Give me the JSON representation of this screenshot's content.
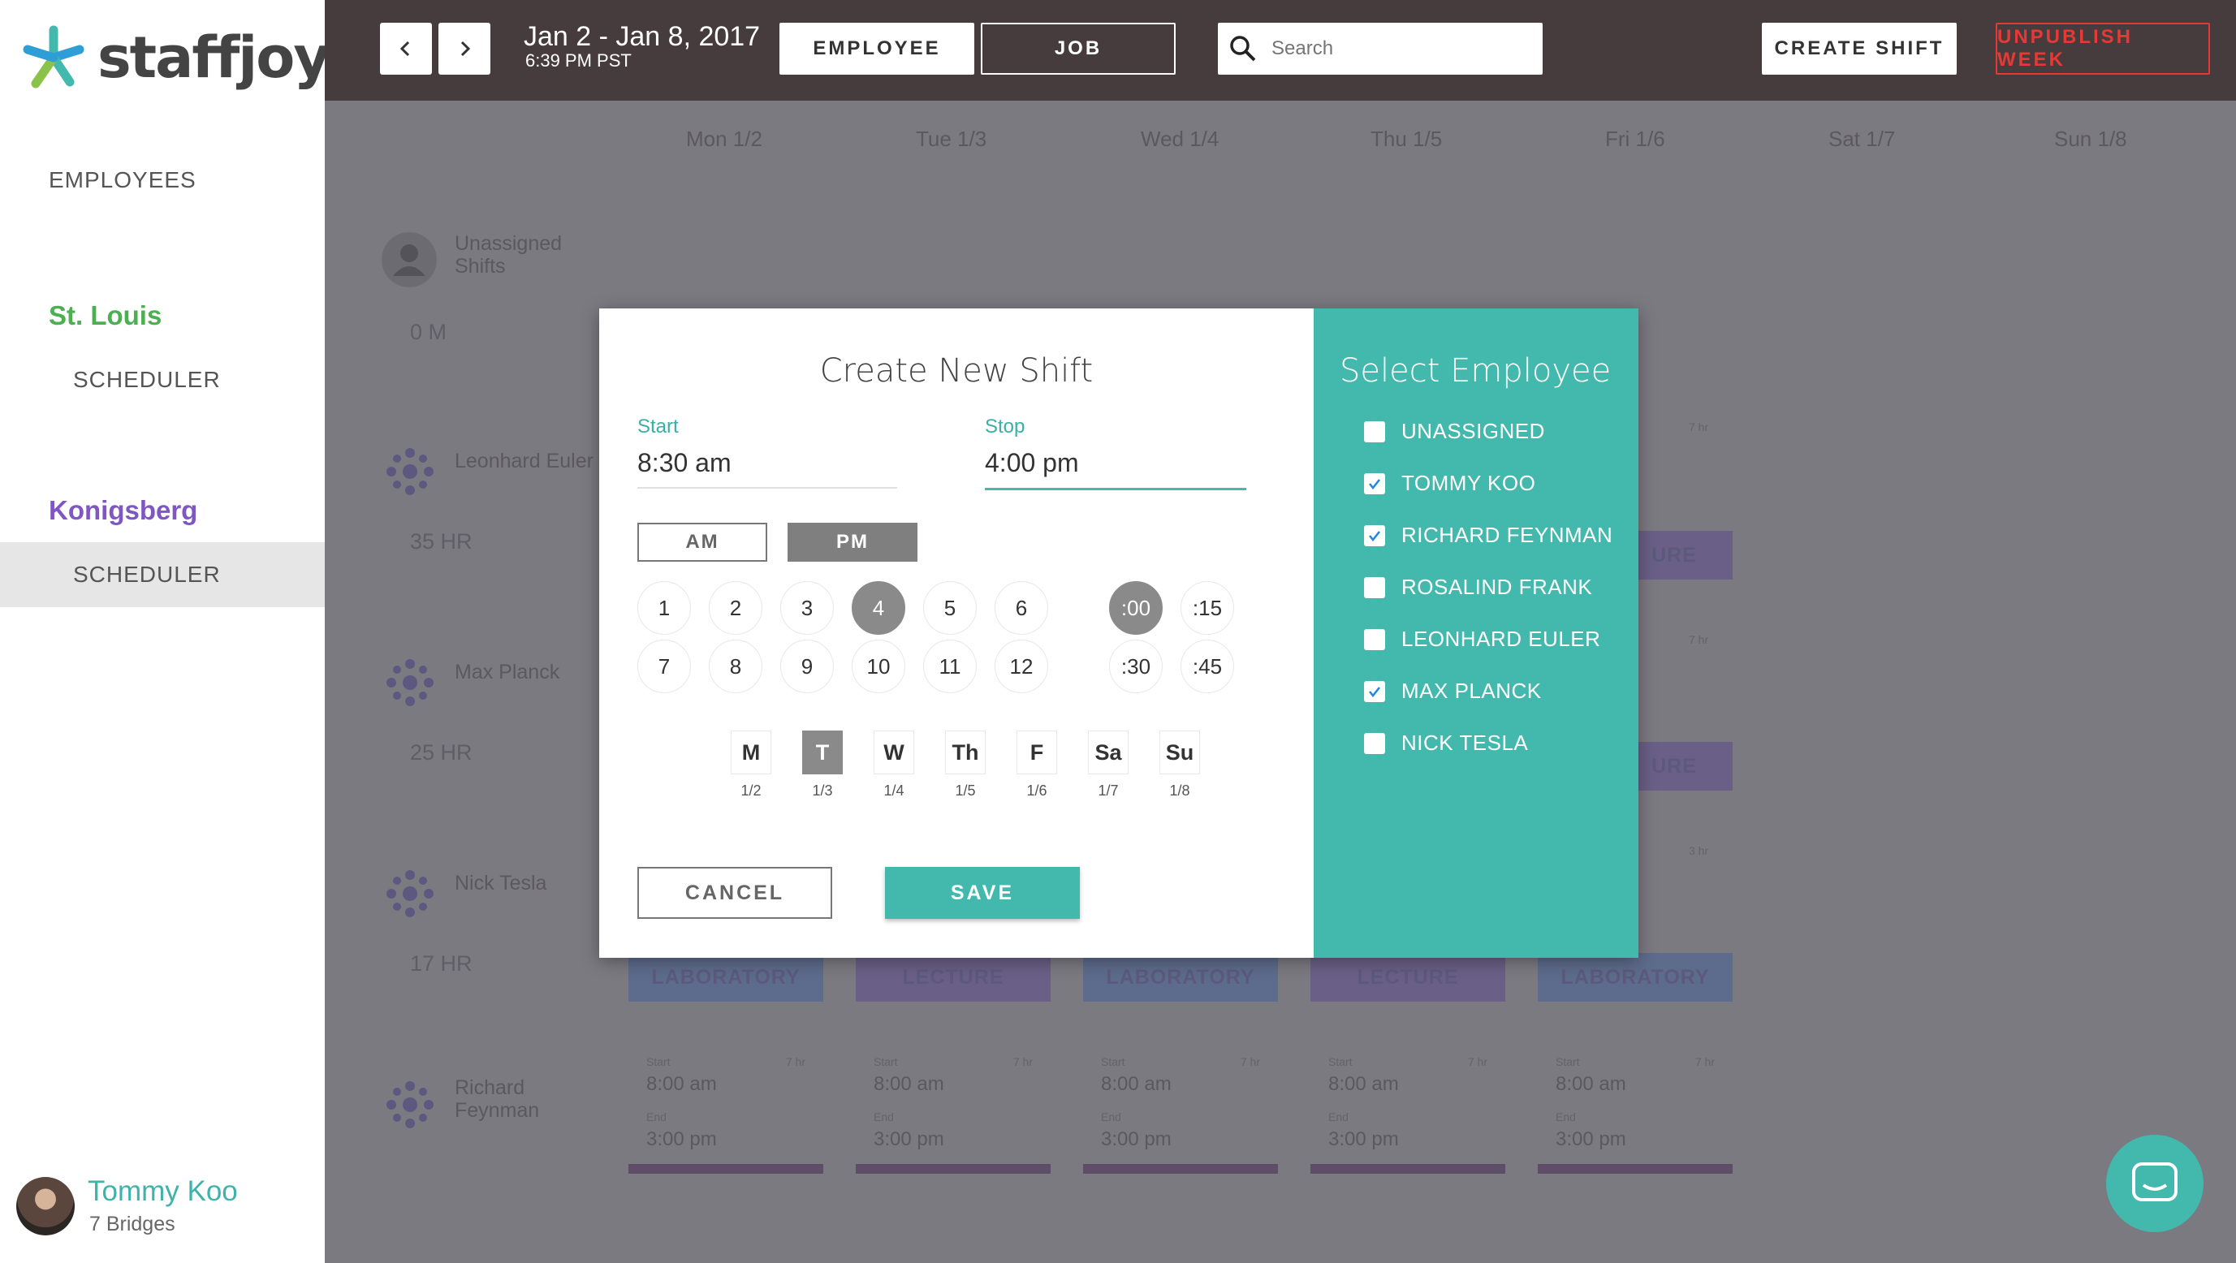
{
  "app": {
    "logo_text": "staffjoy"
  },
  "sidebar": {
    "employees_link": "EMPLOYEES",
    "locations": [
      {
        "name": "St. Louis",
        "color": "#4caf50",
        "sub": "SCHEDULER"
      },
      {
        "name": "Konigsberg",
        "color": "#7e57c2",
        "sub": "SCHEDULER"
      }
    ],
    "user": {
      "name": "Tommy Koo",
      "org": "7 Bridges"
    }
  },
  "header": {
    "date_range": "Jan 2 - Jan 8, 2017",
    "time": "6:39 PM PST",
    "view_employee": "EMPLOYEE",
    "view_job": "JOB",
    "search_placeholder": "Search",
    "create_shift": "CREATE SHIFT",
    "unpublish_week": "UNPUBLISH WEEK"
  },
  "calendar": {
    "days": [
      "Mon 1/2",
      "Tue 1/3",
      "Wed 1/4",
      "Thu 1/5",
      "Fri 1/6",
      "Sat 1/7",
      "Sun 1/8"
    ],
    "unassigned": {
      "name": "Unassigned Shifts",
      "hours": "0 M"
    },
    "rows": [
      {
        "name": "Leonhard Euler",
        "hours": "35 HR"
      },
      {
        "name": "Max Planck",
        "hours": "25 HR"
      },
      {
        "name": "Nick Tesla",
        "hours": "17 HR"
      },
      {
        "name": "Richard Feynman",
        "hours": ""
      }
    ],
    "labels": {
      "lecture": "LECTURE",
      "laboratory": "LABORATORY",
      "ure": "URE",
      "seven_hr": "7 hr",
      "three_hr": "3 hr",
      "start": "Start",
      "end": "End",
      "start_time": "8:00 am",
      "end_time": "3:00 pm"
    },
    "block_row": [
      "LABORATORY",
      "LECTURE",
      "LABORATORY",
      "LECTURE",
      "LABORATORY"
    ]
  },
  "modal": {
    "title": "Create New Shift",
    "start_label": "Start",
    "start_value": "8:30 am",
    "stop_label": "Stop",
    "stop_value": "4:00 pm",
    "am": "AM",
    "pm": "PM",
    "hours": [
      "1",
      "2",
      "3",
      "4",
      "5",
      "6",
      "7",
      "8",
      "9",
      "10",
      "11",
      "12"
    ],
    "selected_hour": "4",
    "minutes": [
      ":00",
      ":15",
      ":30",
      ":45"
    ],
    "selected_minute": ":00",
    "days": [
      {
        "label": "M",
        "date": "1/2"
      },
      {
        "label": "T",
        "date": "1/3",
        "selected": true
      },
      {
        "label": "W",
        "date": "1/4"
      },
      {
        "label": "Th",
        "date": "1/5"
      },
      {
        "label": "F",
        "date": "1/6"
      },
      {
        "label": "Sa",
        "date": "1/7"
      },
      {
        "label": "Su",
        "date": "1/8"
      }
    ],
    "cancel": "CANCEL",
    "save": "SAVE",
    "select_title": "Select Employee",
    "employees": [
      {
        "name": "UNASSIGNED",
        "checked": false
      },
      {
        "name": "TOMMY KOO",
        "checked": true
      },
      {
        "name": "RICHARD FEYNMAN",
        "checked": true
      },
      {
        "name": "ROSALIND FRANK",
        "checked": false
      },
      {
        "name": "LEONHARD EULER",
        "checked": false
      },
      {
        "name": "MAX PLANCK",
        "checked": true
      },
      {
        "name": "NICK TESLA",
        "checked": false
      }
    ]
  },
  "colors": {
    "teal": "#43b8ad",
    "header": "#463c3e",
    "danger": "#e53935"
  }
}
